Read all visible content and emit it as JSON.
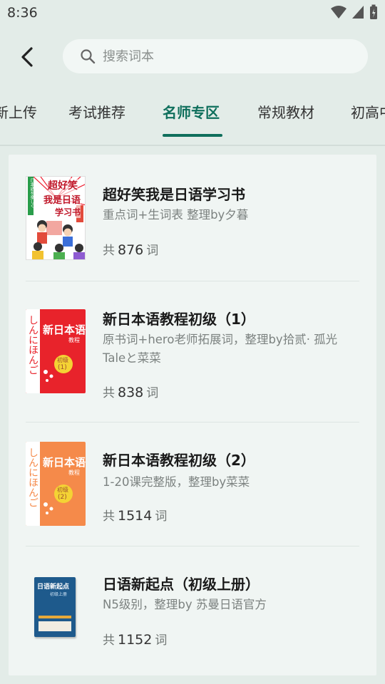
{
  "status_bar": {
    "time": "8:36"
  },
  "search": {
    "placeholder": "搜索词本"
  },
  "tabs": [
    {
      "label": "新上传"
    },
    {
      "label": "考试推荐"
    },
    {
      "label": "名师专区",
      "active": true
    },
    {
      "label": "常规教材"
    },
    {
      "label": "初高中"
    }
  ],
  "colors": {
    "accent": "#0f6f5c",
    "background": "#e3ece8",
    "card": "#f0f5f3"
  },
  "books": [
    {
      "title": "超好笑我是日语学习书",
      "desc": "重点词+生词表 整理by夕暮",
      "count_prefix": "共",
      "count": "876",
      "count_suffix": "词",
      "cover": {
        "title_top": "超好笑",
        "title_mid": "我是日语",
        "title_bottom": "学习书",
        "spine": "日本語を楽しく"
      }
    },
    {
      "title": "新日本语教程初级（1）",
      "desc": "原书词+hero老师拓展词，整理by拾贰· 孤光Taleと菜菜",
      "count_prefix": "共",
      "count": "838",
      "count_suffix": "词",
      "cover": {
        "title": "新日本语",
        "subtitle": "教程",
        "kana": "しんにほんご",
        "level": "初级",
        "level_num": "(1)"
      }
    },
    {
      "title": "新日本语教程初级（2）",
      "desc": "1-20课完整版，整理by菜菜",
      "count_prefix": "共",
      "count": "1514",
      "count_suffix": "词",
      "cover": {
        "title": "新日本语",
        "subtitle": "教程",
        "kana": "しんにほんご",
        "level": "初级",
        "level_num": "(2)"
      }
    },
    {
      "title": "日语新起点（初级上册）",
      "desc": "N5级别，整理by 苏曼日语官方",
      "count_prefix": "共",
      "count": "1152",
      "count_suffix": "词",
      "cover": {
        "title": "日语新起点",
        "subtitle": "初级上册"
      }
    }
  ]
}
